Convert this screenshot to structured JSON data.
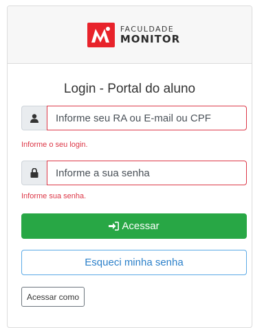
{
  "logo": {
    "line1": "FACULDADE",
    "line2": "MONITOR",
    "brand_color": "#e8232b"
  },
  "login": {
    "title": "Login - Portal do aluno",
    "user_field": {
      "placeholder": "Informe seu RA ou E-mail ou CPF",
      "value": "",
      "icon": "user-icon",
      "error": "Informe o seu login."
    },
    "password_field": {
      "placeholder": "Informe a sua senha",
      "value": "",
      "icon": "lock-icon",
      "error": "Informe sua senha."
    },
    "submit_label": "Acessar",
    "submit_icon": "sign-in-icon",
    "forgot_label": "Esqueci minha senha",
    "access_as_label": "Acessar como"
  },
  "colors": {
    "success": "#28a745",
    "danger": "#dc3545",
    "info_border": "#5aa9e6",
    "info_text": "#2a7fc9"
  }
}
